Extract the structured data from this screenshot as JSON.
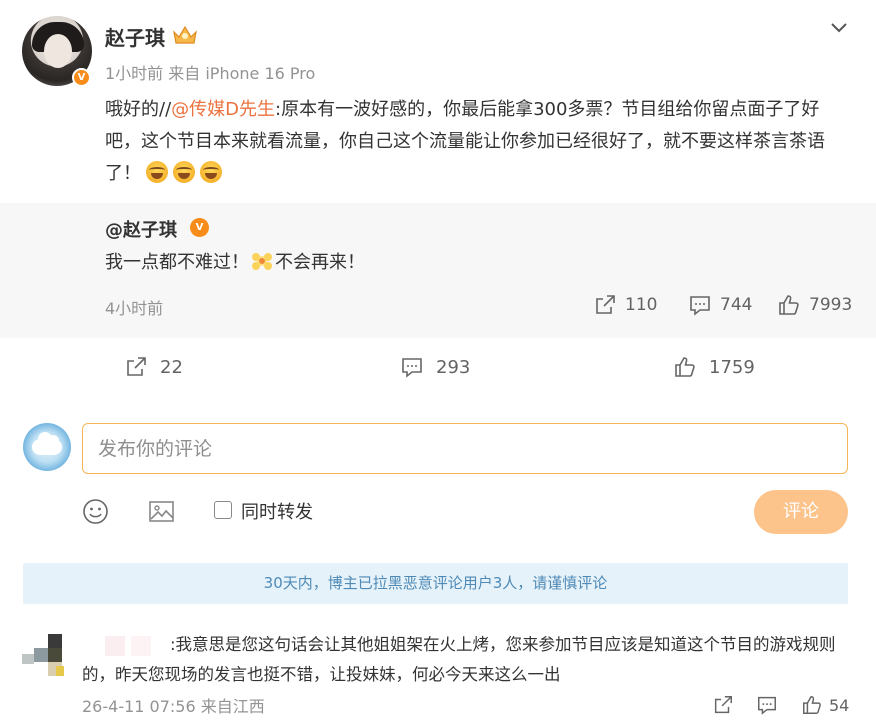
{
  "post": {
    "author": "赵子琪",
    "meta": "1小时前  来自 iPhone 16 Pro",
    "content": {
      "prefix": "哦好的//",
      "mention": "@传媒D先生",
      "body": ":原本有一波好感的，你最后能拿300多票？节目组给你留点面子了好吧，这个节目本来就看流量，你自己这个流量能让你参加已经很好了，就不要这样茶言茶语了！"
    },
    "repost": {
      "author": "@赵子琪",
      "text_before": "我一点都不难过！",
      "text_after": "不会再来！",
      "time": "4小时前",
      "shares": "110",
      "comments": "744",
      "likes": "7993"
    },
    "actions": {
      "shares": "22",
      "comments": "293",
      "likes": "1759"
    }
  },
  "composer": {
    "placeholder": "发布你的评论",
    "repost_label": "同时转发",
    "submit_label": "评论"
  },
  "notice": "30天内，博主已拉黑恶意评论用户3人，请谨慎评论",
  "comment": {
    "text": ":我意思是您这句话会让其他姐姐架在火上烤，您来参加节目应该是知道这个节目的游戏规则的，昨天您现场的发言也挺不错，让投妹妹，何必今天来这么一出",
    "meta": "26-4-11 07:56 来自江西",
    "likes": "54"
  },
  "colors": {
    "accent": "#f78c1a",
    "mention": "#eb7340",
    "submit": "#fcc38a",
    "notice_bg": "#e5f2fa",
    "notice_text": "#4f8ab6"
  }
}
